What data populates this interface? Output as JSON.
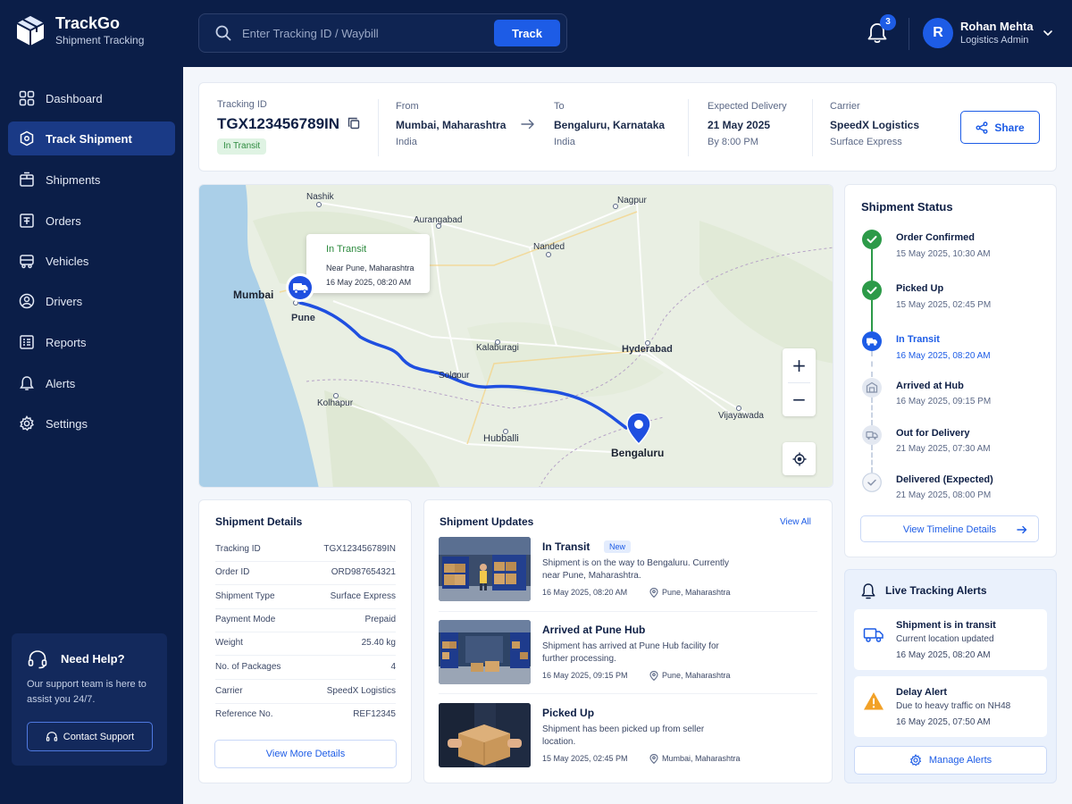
{
  "brand": {
    "name": "TrackGo",
    "subtitle": "Shipment Tracking"
  },
  "search": {
    "placeholder": "Enter Tracking ID / Waybill",
    "button": "Track"
  },
  "notifications": {
    "count": "3"
  },
  "user": {
    "initial": "R",
    "name": "Rohan Mehta",
    "role": "Logistics Admin"
  },
  "sidebar": {
    "items": [
      {
        "label": "Dashboard",
        "icon": "dashboard-icon"
      },
      {
        "label": "Track Shipment",
        "icon": "track-shipment-icon",
        "active": true
      },
      {
        "label": "Shipments",
        "icon": "package-icon"
      },
      {
        "label": "Orders",
        "icon": "orders-icon"
      },
      {
        "label": "Vehicles",
        "icon": "vehicle-icon"
      },
      {
        "label": "Drivers",
        "icon": "driver-icon"
      },
      {
        "label": "Reports",
        "icon": "reports-icon"
      },
      {
        "label": "Alerts",
        "icon": "bell-icon"
      },
      {
        "label": "Settings",
        "icon": "gear-icon"
      }
    ],
    "help": {
      "title": "Need Help?",
      "text": "Our support team is here to assist you 24/7.",
      "button": "Contact Support"
    }
  },
  "summary": {
    "tracking_label": "Tracking ID",
    "tracking_id": "TGX123456789IN",
    "status": "In Transit",
    "from_label": "From",
    "from_city": "Mumbai, Maharashtra",
    "from_country": "India",
    "to_label": "To",
    "to_city": "Bengaluru, Karnataka",
    "to_country": "India",
    "delivery_label": "Expected Delivery",
    "delivery_date": "21 May 2025",
    "delivery_time": "By 8:00 PM",
    "carrier_label": "Carrier",
    "carrier_name": "SpeedX Logistics",
    "carrier_service": "Surface Express",
    "share": "Share"
  },
  "map": {
    "cities": {
      "nashik": "Nashik",
      "nagpur": "Nagpur",
      "aurangabad": "Aurangabad",
      "mumbai": "Mumbai",
      "pune": "Pune",
      "nanded": "Nanded",
      "hyderabad": "Hyderabad",
      "kalaburagi": "Kalaburagi",
      "solapur": "Solapur",
      "kolhapur": "Kolhapur",
      "vijayawada": "Vijayawada",
      "hubballi": "Hubballi",
      "bengaluru": "Bengaluru"
    },
    "popup": {
      "status": "In Transit",
      "location": "Near Pune, Maharashtra",
      "time": "16 May 2025, 08:20 AM"
    },
    "zoom_in": "+",
    "zoom_out": "−"
  },
  "status_card": {
    "title": "Shipment Status",
    "steps": [
      {
        "label": "Order Confirmed",
        "time": "15 May 2025, 10:30 AM",
        "state": "done"
      },
      {
        "label": "Picked Up",
        "time": "15 May 2025, 02:45 PM",
        "state": "done"
      },
      {
        "label": "In Transit",
        "time": "16 May 2025, 08:20 AM",
        "state": "current"
      },
      {
        "label": "Arrived at Hub",
        "time": "16 May 2025, 09:15 PM",
        "state": "pending"
      },
      {
        "label": "Out for Delivery",
        "time": "21 May 2025, 07:30 AM",
        "state": "pending"
      },
      {
        "label": "Delivered (Expected)",
        "time": "21 May 2025, 08:00 PM",
        "state": "pending"
      }
    ],
    "button": "View Timeline Details"
  },
  "alerts": {
    "title": "Live Tracking Alerts",
    "items": [
      {
        "title": "Shipment is in transit",
        "text": "Current location updated",
        "time": "16 May 2025, 08:20 AM"
      },
      {
        "title": "Delay Alert",
        "text": "Due to heavy traffic on NH48",
        "time": "16 May 2025, 07:50 AM"
      }
    ],
    "button": "Manage Alerts"
  },
  "details": {
    "title": "Shipment Details",
    "rows": [
      {
        "key": "Tracking ID",
        "value": "TGX123456789IN"
      },
      {
        "key": "Order ID",
        "value": "ORD987654321"
      },
      {
        "key": "Shipment Type",
        "value": "Surface Express"
      },
      {
        "key": "Payment Mode",
        "value": "Prepaid"
      },
      {
        "key": "Weight",
        "value": "25.40 kg"
      },
      {
        "key": "No. of Packages",
        "value": "4"
      },
      {
        "key": "Carrier",
        "value": "SpeedX Logistics"
      },
      {
        "key": "Reference No.",
        "value": "REF12345"
      }
    ],
    "button": "View More Details"
  },
  "updates": {
    "title": "Shipment Updates",
    "view_all": "View All",
    "items": [
      {
        "title": "In Transit",
        "badge": "New",
        "desc": "Shipment is on the way to Bengaluru. Currently near Pune, Maharashtra.",
        "time": "16 May 2025, 08:20 AM",
        "location": "Pune, Maharashtra"
      },
      {
        "title": "Arrived at Pune Hub",
        "desc": "Shipment has arrived at Pune Hub facility for further processing.",
        "time": "16 May 2025, 09:15 PM",
        "location": "Pune, Maharashtra"
      },
      {
        "title": "Picked Up",
        "desc": "Shipment has been picked up from seller location.",
        "time": "15 May 2025, 02:45 PM",
        "location": "Mumbai, Maharashtra"
      }
    ]
  },
  "colors": {
    "navy": "#0b1e48",
    "accent": "#1d5ce6",
    "success": "#2c9a48",
    "warning": "#f2a127"
  }
}
